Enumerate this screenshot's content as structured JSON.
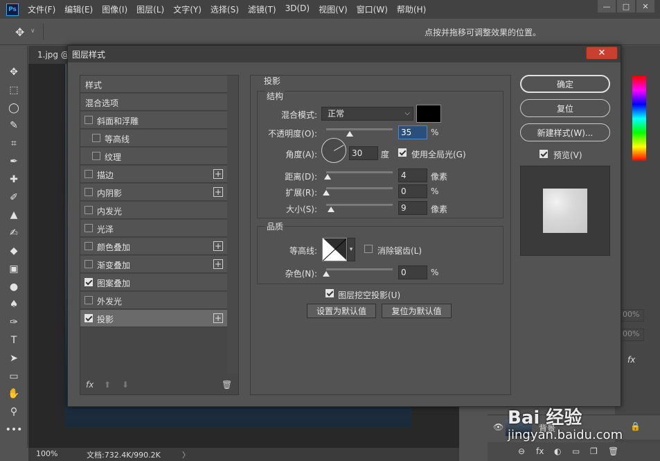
{
  "menubar": {
    "logo": "Ps",
    "items": [
      "文件(F)",
      "编辑(E)",
      "图像(I)",
      "图层(L)",
      "文字(Y)",
      "选择(S)",
      "滤镜(T)",
      "3D(D)",
      "视图(V)",
      "窗口(W)",
      "帮助(H)"
    ],
    "window_controls": [
      "—",
      "□",
      "✕"
    ]
  },
  "options_bar": {
    "tool_glyph": "✥",
    "caret": "∨",
    "hint": "点按并拖移可调整效果的位置。"
  },
  "document": {
    "tab_label": "1.jpg @",
    "zoom": "100%",
    "doc_size": "文档:732.4K/990.2K",
    "arrow": "〉"
  },
  "toolbox": {
    "tools": [
      {
        "name": "move-tool-icon",
        "glyph": "✥"
      },
      {
        "name": "marquee-tool-icon",
        "glyph": "⬚"
      },
      {
        "name": "lasso-tool-icon",
        "glyph": "◯"
      },
      {
        "name": "quick-select-tool-icon",
        "glyph": "✎"
      },
      {
        "name": "crop-tool-icon",
        "glyph": "⌗"
      },
      {
        "name": "eyedropper-tool-icon",
        "glyph": "✒"
      },
      {
        "name": "healing-brush-tool-icon",
        "glyph": "✚"
      },
      {
        "name": "brush-tool-icon",
        "glyph": "✐"
      },
      {
        "name": "stamp-tool-icon",
        "glyph": "▲"
      },
      {
        "name": "history-brush-tool-icon",
        "glyph": "✍"
      },
      {
        "name": "eraser-tool-icon",
        "glyph": "◆"
      },
      {
        "name": "gradient-tool-icon",
        "glyph": "▣"
      },
      {
        "name": "blur-tool-icon",
        "glyph": "●"
      },
      {
        "name": "dodge-tool-icon",
        "glyph": "♠"
      },
      {
        "name": "pen-tool-icon",
        "glyph": "✑"
      },
      {
        "name": "type-tool-icon",
        "glyph": "T"
      },
      {
        "name": "path-select-tool-icon",
        "glyph": "➤"
      },
      {
        "name": "shape-tool-icon",
        "glyph": "▭"
      },
      {
        "name": "hand-tool-icon",
        "glyph": "✋"
      },
      {
        "name": "zoom-tool-icon",
        "glyph": "⚲"
      },
      {
        "name": "more-tools-icon",
        "glyph": "•••"
      }
    ]
  },
  "layers": {
    "layer_name": "背景",
    "eye_glyph": "👁",
    "lock_glyph": "🔒",
    "fx_label": "fx",
    "opacity_partial": "00%",
    "fill_partial": "00%",
    "footer_icons": [
      "⊖",
      "fx",
      "◐",
      "▭",
      "❐",
      "🗑"
    ]
  },
  "dialog": {
    "title": "图层样式",
    "close_glyph": "✕",
    "style_list": {
      "items": [
        {
          "label": "样式",
          "checkbox": false,
          "checked": false,
          "plus": false,
          "indent": 0,
          "selected": false
        },
        {
          "label": "混合选项",
          "checkbox": false,
          "checked": false,
          "plus": false,
          "indent": 0,
          "selected": false
        },
        {
          "label": "斜面和浮雕",
          "checkbox": true,
          "checked": false,
          "plus": false,
          "indent": 0,
          "selected": false
        },
        {
          "label": "等高线",
          "checkbox": true,
          "checked": false,
          "plus": false,
          "indent": 1,
          "selected": false
        },
        {
          "label": "纹理",
          "checkbox": true,
          "checked": false,
          "plus": false,
          "indent": 1,
          "selected": false
        },
        {
          "label": "描边",
          "checkbox": true,
          "checked": false,
          "plus": true,
          "indent": 0,
          "selected": false
        },
        {
          "label": "内阴影",
          "checkbox": true,
          "checked": false,
          "plus": true,
          "indent": 0,
          "selected": false
        },
        {
          "label": "内发光",
          "checkbox": true,
          "checked": false,
          "plus": false,
          "indent": 0,
          "selected": false
        },
        {
          "label": "光泽",
          "checkbox": true,
          "checked": false,
          "plus": false,
          "indent": 0,
          "selected": false
        },
        {
          "label": "颜色叠加",
          "checkbox": true,
          "checked": false,
          "plus": true,
          "indent": 0,
          "selected": false
        },
        {
          "label": "渐变叠加",
          "checkbox": true,
          "checked": false,
          "plus": true,
          "indent": 0,
          "selected": false
        },
        {
          "label": "图案叠加",
          "checkbox": true,
          "checked": true,
          "plus": false,
          "indent": 0,
          "selected": false
        },
        {
          "label": "外发光",
          "checkbox": true,
          "checked": false,
          "plus": false,
          "indent": 0,
          "selected": false
        },
        {
          "label": "投影",
          "checkbox": true,
          "checked": true,
          "plus": true,
          "indent": 0,
          "selected": true
        }
      ],
      "plus_glyph": "+",
      "footer": {
        "fx": "fx",
        "up": "⬆",
        "down": "⬇",
        "trash": "🗑"
      }
    },
    "drop_shadow": {
      "section_title": "投影",
      "structure": {
        "title": "结构",
        "blend_mode_label": "混合模式:",
        "blend_mode_value": "正常",
        "caret": "⌵",
        "shadow_color": "#000000",
        "opacity_label": "不透明度(O):",
        "opacity_value": "35",
        "opacity_fraction": 0.35,
        "percent": "%",
        "angle_label": "角度(A):",
        "angle_value": "30",
        "angle_unit": "度",
        "global_light_label": "使用全局光(G)",
        "global_light_checked": true,
        "distance_label": "距离(D):",
        "distance_value": "4",
        "distance_fraction": 0.02,
        "pixel_unit": "像素",
        "spread_label": "扩展(R):",
        "spread_value": "0",
        "spread_fraction": 0.0,
        "size_label": "大小(S):",
        "size_value": "9",
        "size_fraction": 0.07
      },
      "quality": {
        "title": "品质",
        "contour_label": "等高线:",
        "antialias_label": "消除锯齿(L)",
        "antialias_checked": false,
        "noise_label": "杂色(N):",
        "noise_value": "0",
        "noise_fraction": 0.0
      },
      "knockout_label": "图层挖空投影(U)",
      "knockout_checked": true,
      "set_default": "设置为默认值",
      "reset_default": "复位为默认值"
    },
    "buttons": {
      "ok": "确定",
      "reset": "复位",
      "new_style": "新建样式(W)...",
      "preview_label": "预览(V)",
      "preview_checked": true
    }
  },
  "watermark": {
    "text": "Bai 经验",
    "url": "jingyan.baidu.com"
  }
}
